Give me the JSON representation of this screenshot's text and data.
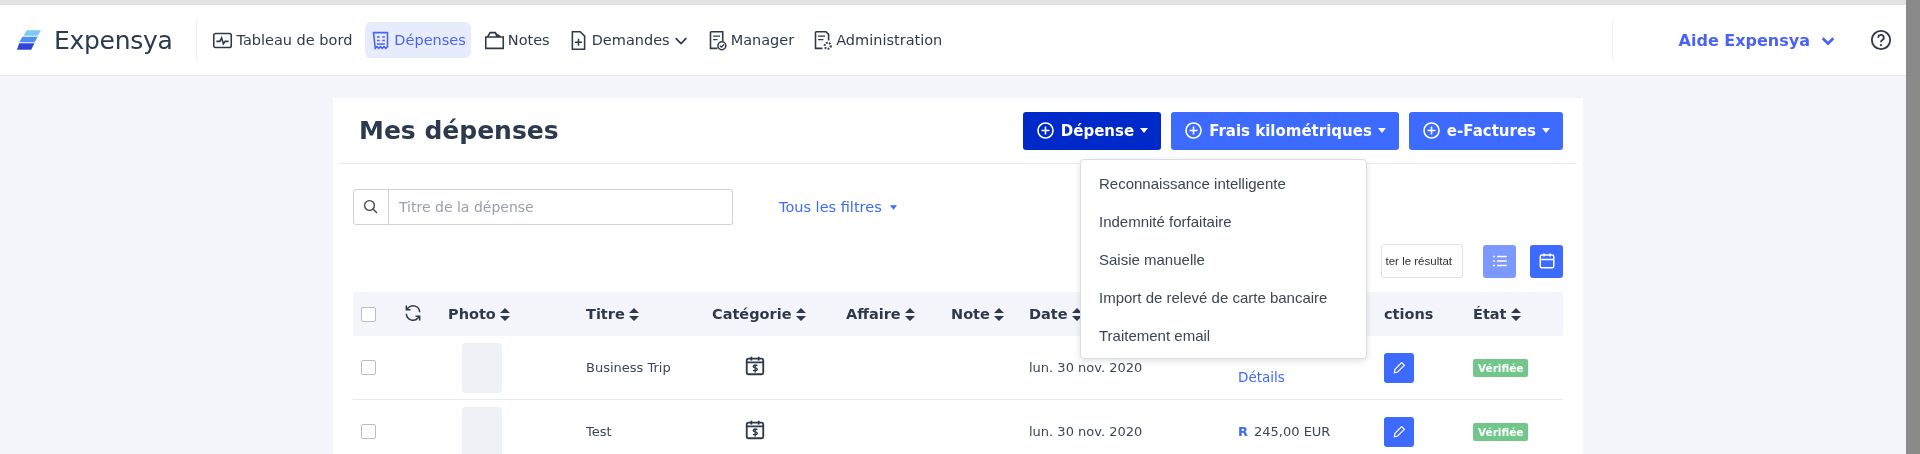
{
  "topbar": {
    "logo": "Expensya",
    "nav": [
      {
        "label": "Tableau de bord",
        "selected": false,
        "caret": false
      },
      {
        "label": "Dépenses",
        "selected": true,
        "caret": false
      },
      {
        "label": "Notes",
        "selected": false,
        "caret": false
      },
      {
        "label": "Demandes",
        "selected": false,
        "caret": true
      },
      {
        "label": "Manager",
        "selected": false,
        "caret": false
      },
      {
        "label": "Administration",
        "selected": false,
        "caret": false
      }
    ],
    "help": "Aide Expensya"
  },
  "page": {
    "title": "Mes dépenses",
    "actions": [
      {
        "label": "Dépense",
        "selected": true
      },
      {
        "label": "Frais kilométriques",
        "selected": false
      },
      {
        "label": "e-Factures",
        "selected": false
      }
    ],
    "search": {
      "placeholder": "Titre de la dépense"
    },
    "filters": "Tous les filtres",
    "export": "ter le résultat",
    "views": [
      {
        "kind": "list",
        "selected": false
      },
      {
        "kind": "calendar",
        "selected": true
      }
    ],
    "dropdown": [
      "Reconnaissance intelligente",
      "Indemnité forfaitaire",
      "Saisie manuelle",
      "Import de relevé de carte bancaire",
      "Traitement email"
    ],
    "table": {
      "select_all": {
        "checked": false
      },
      "columns": [
        {
          "label": "Photo",
          "sortable": true
        },
        {
          "label": "Titre",
          "sortable": true
        },
        {
          "label": "Catégorie",
          "sortable": true
        },
        {
          "label": "Affaire",
          "sortable": true
        },
        {
          "label": "Note",
          "sortable": true
        },
        {
          "label": "Date",
          "sortable": true
        },
        {
          "label": "ctions",
          "sortable": false
        },
        {
          "label": "État",
          "sortable": true
        }
      ],
      "rows": [
        {
          "checked": false,
          "title": "Business Trip",
          "date": "lun. 30 nov. 2020",
          "details": "Détails",
          "status": "Vérifiée"
        },
        {
          "checked": false,
          "title": "Test",
          "date": "lun. 30 nov. 2020",
          "amount_mark": "R",
          "amount": "245,00 EUR",
          "status": "Vérifiée"
        }
      ]
    }
  }
}
